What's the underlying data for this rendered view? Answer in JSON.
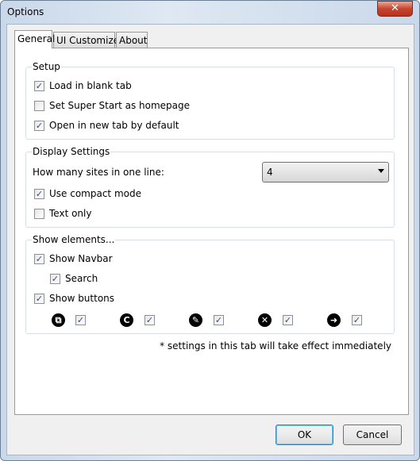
{
  "window": {
    "title": "Options",
    "close_glyph": "✕"
  },
  "tabs": [
    {
      "label": "General",
      "active": true
    },
    {
      "label": "UI Customize",
      "active": false
    },
    {
      "label": "About",
      "active": false
    }
  ],
  "setup": {
    "title": "Setup",
    "items": [
      {
        "label": "Load in blank tab",
        "checked": true
      },
      {
        "label": "Set Super Start as homepage",
        "checked": false
      },
      {
        "label": "Open in new tab by default",
        "checked": true
      }
    ]
  },
  "display": {
    "title": "Display Settings",
    "sites_label": "How many sites in one line:",
    "sites_value": "4",
    "items": [
      {
        "label": "Use compact mode",
        "checked": true
      },
      {
        "label": "Text only",
        "checked": false
      }
    ]
  },
  "elements": {
    "title": "Show elements...",
    "navbar": {
      "label": "Show Navbar",
      "checked": true
    },
    "search": {
      "label": "Search",
      "checked": true
    },
    "buttons": {
      "label": "Show buttons",
      "checked": true
    },
    "button_icons": [
      {
        "icon": "open-tab-icon",
        "glyph": "⧉",
        "checked": true
      },
      {
        "icon": "refresh-icon",
        "glyph": "C",
        "checked": true
      },
      {
        "icon": "edit-icon",
        "glyph": "✎",
        "checked": true
      },
      {
        "icon": "close-icon",
        "glyph": "✕",
        "checked": true
      },
      {
        "icon": "arrow-right-icon",
        "glyph": "➜",
        "checked": true
      }
    ]
  },
  "note": "* settings in this tab will take effect immediately",
  "footer": {
    "ok": "OK",
    "cancel": "Cancel"
  },
  "check_glyph": "✓"
}
